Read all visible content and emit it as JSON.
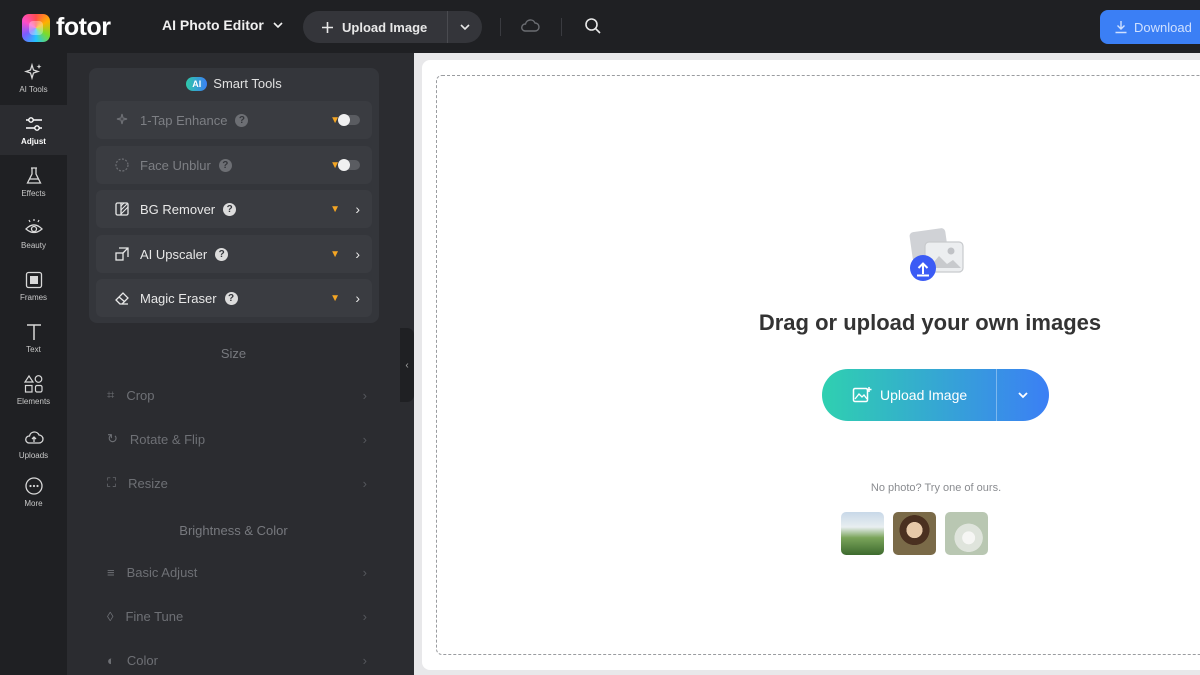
{
  "header": {
    "brand": "fotor",
    "editor_menu": "AI Photo Editor",
    "upload_label": "Upload Image",
    "download_label": "Download"
  },
  "nav": {
    "items": [
      {
        "label": "AI Tools",
        "icon": "sparkles-icon"
      },
      {
        "label": "Adjust",
        "icon": "sliders-icon"
      },
      {
        "label": "Effects",
        "icon": "flask-icon"
      },
      {
        "label": "Beauty",
        "icon": "eye-icon"
      },
      {
        "label": "Frames",
        "icon": "frame-icon"
      },
      {
        "label": "Text",
        "icon": "text-icon"
      },
      {
        "label": "Elements",
        "icon": "shapes-icon"
      },
      {
        "label": "Uploads",
        "icon": "cloud-upload-icon"
      },
      {
        "label": "More",
        "icon": "more-icon"
      }
    ],
    "active": "Adjust"
  },
  "smart_tools": {
    "title": "Smart Tools",
    "badge": "AI",
    "tools": [
      {
        "label": "1-Tap Enhance",
        "control": "toggle"
      },
      {
        "label": "Face Unblur",
        "control": "toggle"
      },
      {
        "label": "BG Remover",
        "control": "chevron"
      },
      {
        "label": "AI Upscaler",
        "control": "chevron"
      },
      {
        "label": "Magic Eraser",
        "control": "chevron"
      }
    ]
  },
  "sections": {
    "size_title": "Size",
    "size_items": [
      "Crop",
      "Rotate & Flip",
      "Resize"
    ],
    "bc_title": "Brightness & Color",
    "bc_items": [
      "Basic Adjust",
      "Fine Tune",
      "Color"
    ]
  },
  "canvas": {
    "title": "Drag or upload your own images",
    "upload_label": "Upload Image",
    "no_photo": "No photo? Try one of ours."
  },
  "colors": {
    "accent": "#3b7ff5",
    "gradient_start": "#2fd0b0",
    "crown": "#f5a623"
  }
}
